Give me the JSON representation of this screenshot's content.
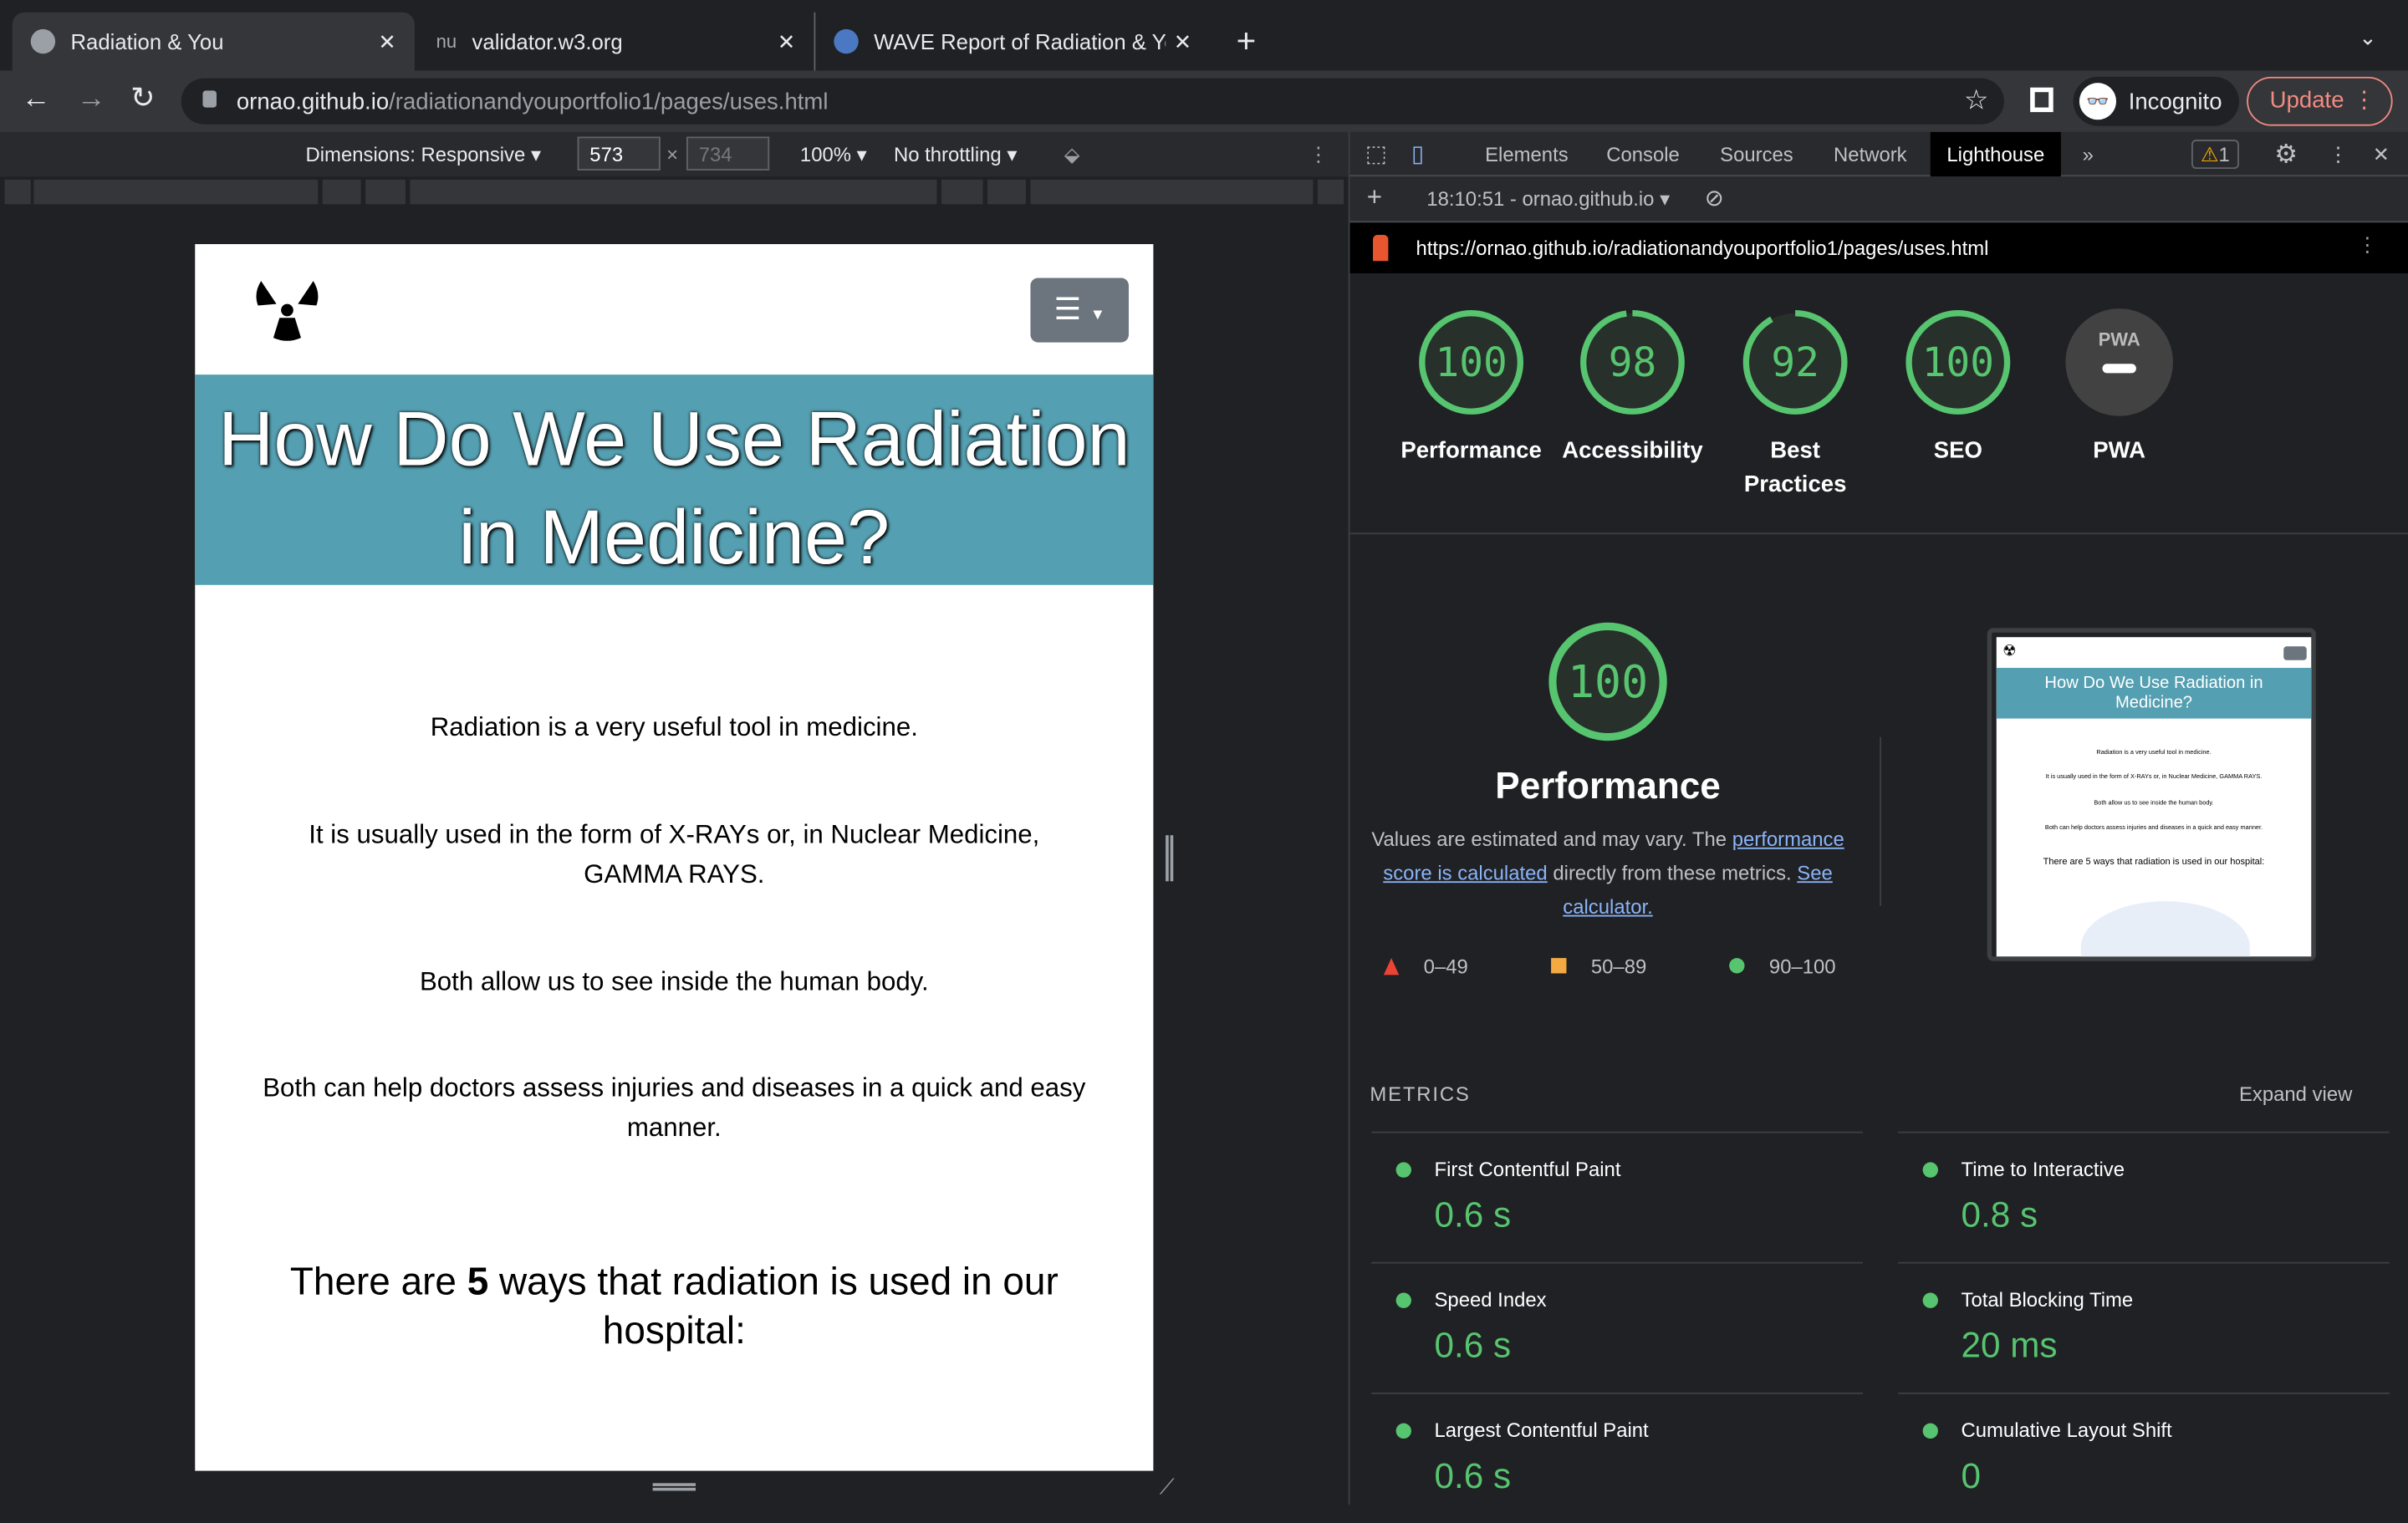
{
  "browser": {
    "tabs": [
      {
        "title": "Radiation & You",
        "active": true
      },
      {
        "title": "validator.w3.org",
        "active": false
      },
      {
        "title": "WAVE Report of Radiation & You",
        "active": false
      }
    ],
    "url_domain": "ornao.github.io",
    "url_path": "/radiationandyouportfolio1/pages/uses.html",
    "profile_label": "Incognito",
    "update_label": "Update"
  },
  "device_toolbar": {
    "dimensions": "Dimensions: Responsive",
    "width": "573",
    "height": "734",
    "times": "×",
    "zoom": "100%",
    "throttling": "No throttling"
  },
  "page": {
    "title": "How Do We Use Radiation in Medicine?",
    "paragraphs": [
      "Radiation is a very useful tool in medicine.",
      "It is usually used in the form of X-RAYs or, in Nuclear Medicine, GAMMA RAYS.",
      "Both allow us to see inside the human body.",
      "Both can help doctors assess injuries and diseases in a quick and easy manner."
    ],
    "ways_pre": "There are ",
    "ways_count": "5",
    "ways_post": " ways that radiation is used in our hospital:"
  },
  "devtools": {
    "tabs": [
      "Elements",
      "Console",
      "Sources",
      "Network",
      "Lighthouse"
    ],
    "active_tab": "Lighthouse",
    "warnings": "1",
    "report_select": "18:10:51 - ornao.github.io",
    "report_url": "https://ornao.github.io/radiationandyouportfolio1/pages/uses.html",
    "scores": [
      {
        "label": "Performance",
        "score": 100
      },
      {
        "label": "Accessibility",
        "score": 98
      },
      {
        "label": "Best Practices",
        "score": 92
      },
      {
        "label": "SEO",
        "score": 100
      },
      {
        "label": "PWA",
        "score": null,
        "badge": "PWA"
      }
    ],
    "perf": {
      "score": "100",
      "title": "Performance",
      "desc_pre": "Values are estimated and may vary. The ",
      "link1": "performance score is calculated",
      "desc_mid": " directly from these metrics. ",
      "link2": "See calculator."
    },
    "legend": [
      {
        "range": "0–49",
        "color": "#eb4335"
      },
      {
        "range": "50–89",
        "color": "#f4a943"
      },
      {
        "range": "90–100",
        "color": "#57c46f"
      }
    ],
    "thumb": {
      "title": "How Do We Use Radiation in Medicine?",
      "lines": [
        "Radiation is a very useful tool in medicine.",
        "It is usually used in the form of X-RAYs or, in Nuclear Medicine, GAMMA RAYS.",
        "Both allow us to see inside the human body.",
        "Both can help doctors assess injuries and diseases in a quick and easy manner.",
        "There are 5 ways that radiation is used in our hospital:"
      ]
    },
    "metrics_header": "METRICS",
    "expand": "Expand view",
    "metrics": [
      {
        "label": "First Contentful Paint",
        "value": "0.6 s"
      },
      {
        "label": "Time to Interactive",
        "value": "0.8 s"
      },
      {
        "label": "Speed Index",
        "value": "0.6 s"
      },
      {
        "label": "Total Blocking Time",
        "value": "20 ms"
      },
      {
        "label": "Largest Contentful Paint",
        "value": "0.6 s"
      },
      {
        "label": "Cumulative Layout Shift",
        "value": "0"
      }
    ],
    "pass_color": "#57c46f"
  }
}
